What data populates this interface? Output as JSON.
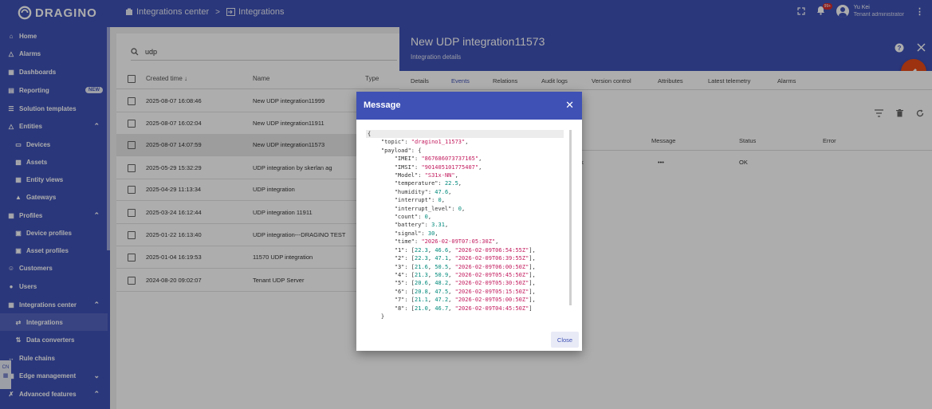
{
  "brand": {
    "name": "DRAGINO"
  },
  "breadcrumb": {
    "parent": "Integrations center",
    "current": "Integrations"
  },
  "header": {
    "notification_badge": "99+",
    "user_name": "Yu Kei",
    "user_role": "Tenant administrator"
  },
  "sidebar": {
    "items": [
      {
        "label": "Home",
        "icon": "home-icon"
      },
      {
        "label": "Alarms",
        "icon": "alarm-icon"
      },
      {
        "label": "Dashboards",
        "icon": "dashboard-icon"
      },
      {
        "label": "Reporting",
        "icon": "report-icon",
        "badge": "NEW"
      },
      {
        "label": "Solution templates",
        "icon": "templates-icon"
      },
      {
        "label": "Entities",
        "icon": "entities-icon"
      },
      {
        "label": "Devices",
        "icon": "device-icon"
      },
      {
        "label": "Assets",
        "icon": "asset-icon"
      },
      {
        "label": "Entity views",
        "icon": "entity-view-icon"
      },
      {
        "label": "Gateways",
        "icon": "gateway-icon"
      },
      {
        "label": "Profiles",
        "icon": "profiles-icon"
      },
      {
        "label": "Device profiles",
        "icon": "device-profile-icon"
      },
      {
        "label": "Asset profiles",
        "icon": "asset-profile-icon"
      },
      {
        "label": "Customers",
        "icon": "customers-icon"
      },
      {
        "label": "Users",
        "icon": "users-icon"
      },
      {
        "label": "Integrations center",
        "icon": "integrations-center-icon"
      },
      {
        "label": "Integrations",
        "icon": "integrations-icon"
      },
      {
        "label": "Data converters",
        "icon": "converter-icon"
      },
      {
        "label": "Rule chains",
        "icon": "rule-chain-icon"
      },
      {
        "label": "Edge management",
        "icon": "edge-icon"
      },
      {
        "label": "Advanced features",
        "icon": "advanced-icon"
      }
    ],
    "lang": "CN"
  },
  "list": {
    "search_value": "udp",
    "columns": {
      "created": "Created time",
      "name": "Name",
      "type": "Type"
    },
    "rows": [
      {
        "created": "2025-08-07 16:08:46",
        "name": "New UDP integration11999"
      },
      {
        "created": "2025-08-07 16:02:04",
        "name": "New UDP integration11911"
      },
      {
        "created": "2025-08-07 14:07:59",
        "name": "New UDP integration11573"
      },
      {
        "created": "2025-05-29 15:32:29",
        "name": "UDP integration by skerlan ag"
      },
      {
        "created": "2025-04-29 11:13:34",
        "name": "UDP integration"
      },
      {
        "created": "2025-03-24 16:12:44",
        "name": "UDP integration 11911"
      },
      {
        "created": "2025-01-22 16:13:40",
        "name": "UDP integration---DRAGINO TEST"
      },
      {
        "created": "2025-01-04 16:19:53",
        "name": "11570 UDP integration"
      },
      {
        "created": "2024-08-20 09:02:07",
        "name": "Tenant UDP Server"
      }
    ]
  },
  "details": {
    "title": "New UDP integration11573",
    "subtitle": "Integration details",
    "tabs": [
      "Details",
      "Events",
      "Relations",
      "Audit logs",
      "Version control",
      "Attributes",
      "Latest telemetry",
      "Alarms"
    ],
    "events": {
      "columns": {
        "message": "Message",
        "status": "Status",
        "error": "Error"
      },
      "row": {
        "type_tail": "k",
        "message": "•••",
        "status": "OK"
      }
    }
  },
  "dialog": {
    "title": "Message",
    "close_label": "Close",
    "json": {
      "topic": "dragino1_11573",
      "IMEI": "867686073737165",
      "IMSI": "901405101775407",
      "Model": "S31x-NN",
      "temperature": "22.5",
      "humidity": "47.6",
      "interrupt": "0",
      "interrupt_level": "0",
      "count": "0",
      "battery": "3.31",
      "signal": "30",
      "time": "2026-02-09T07:05:30Z",
      "history": [
        {
          "key": "1",
          "t": "22.3",
          "h": "46.6",
          "ts": "2026-02-09T06:54:55Z"
        },
        {
          "key": "2",
          "t": "22.3",
          "h": "47.1",
          "ts": "2026-02-09T06:39:55Z"
        },
        {
          "key": "3",
          "t": "21.6",
          "h": "50.5",
          "ts": "2026-02-09T06:00:50Z"
        },
        {
          "key": "4",
          "t": "21.3",
          "h": "50.9",
          "ts": "2026-02-09T05:45:50Z"
        },
        {
          "key": "5",
          "t": "20.6",
          "h": "48.2",
          "ts": "2026-02-09T05:30:50Z"
        },
        {
          "key": "6",
          "t": "20.8",
          "h": "47.5",
          "ts": "2026-02-09T05:15:50Z"
        },
        {
          "key": "7",
          "t": "21.1",
          "h": "47.2",
          "ts": "2026-02-09T05:00:50Z"
        },
        {
          "key": "8",
          "t": "21.0",
          "h": "46.7",
          "ts": "2026-02-09T04:45:50Z"
        }
      ]
    }
  }
}
